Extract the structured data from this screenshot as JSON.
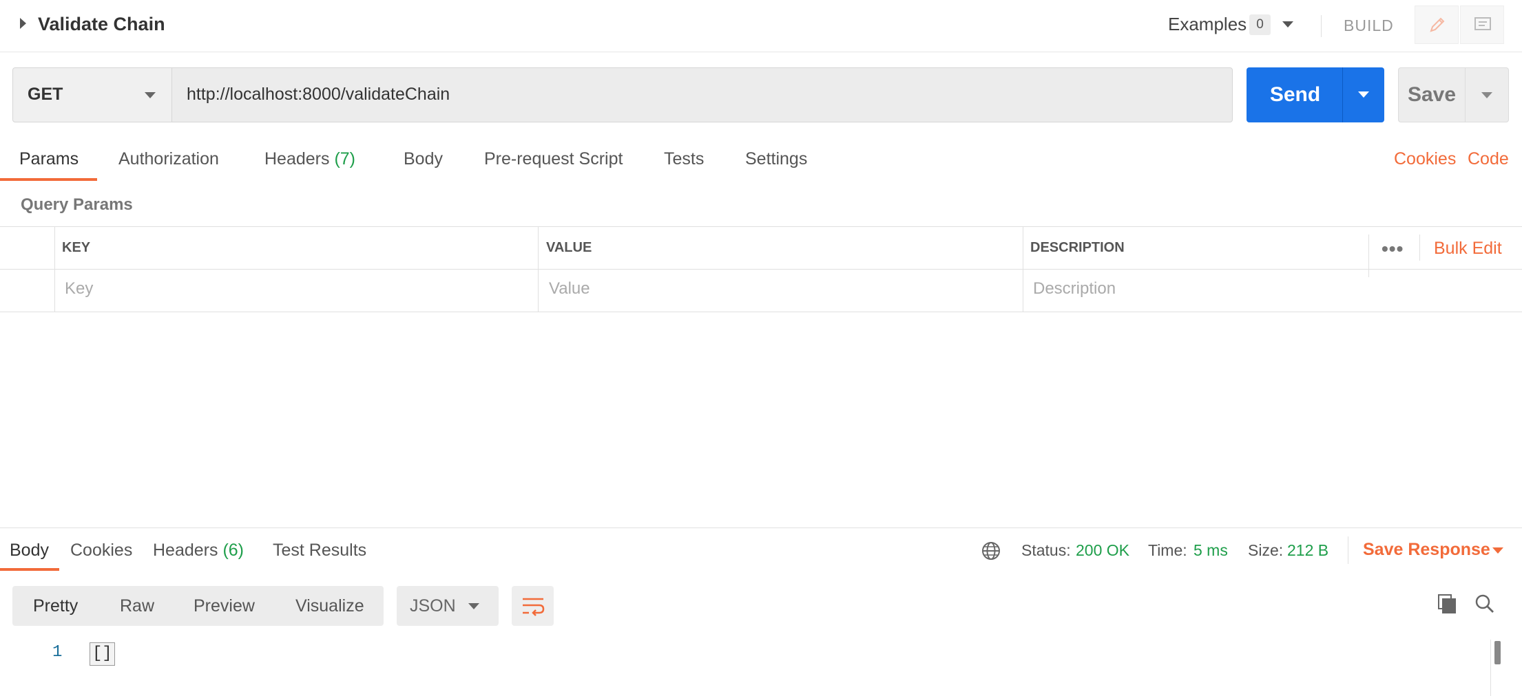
{
  "title_bar": {
    "request_name": "Validate Chain",
    "examples_label": "Examples",
    "examples_count": "0",
    "build_label": "BUILD"
  },
  "request": {
    "method": "GET",
    "url": "http://localhost:8000/validateChain",
    "send_label": "Send",
    "save_label": "Save"
  },
  "request_tabs": {
    "params": "Params",
    "authorization": "Authorization",
    "headers": "Headers",
    "headers_count": "(7)",
    "body": "Body",
    "pre_request_script": "Pre-request Script",
    "tests": "Tests",
    "settings": "Settings"
  },
  "links": {
    "cookies": "Cookies",
    "code": "Code"
  },
  "query_params": {
    "section_label": "Query Params",
    "columns": [
      "KEY",
      "VALUE",
      "DESCRIPTION"
    ],
    "placeholders": [
      "Key",
      "Value",
      "Description"
    ],
    "more_label": "•••",
    "bulk_edit_label": "Bulk Edit"
  },
  "response": {
    "tabs": {
      "body": "Body",
      "cookies": "Cookies",
      "headers": "Headers",
      "headers_count": "(6)",
      "test_results": "Test Results"
    },
    "status_label": "Status:",
    "status_value": "200 OK",
    "time_label": "Time:",
    "time_value": "5 ms",
    "size_label": "Size:",
    "size_value": "212 B",
    "save_response_label": "Save Response",
    "view_modes": [
      "Pretty",
      "Raw",
      "Preview",
      "Visualize"
    ],
    "format": "JSON",
    "lines": [
      {
        "number": "1",
        "text": "[]"
      }
    ]
  },
  "colors": {
    "accent_orange": "#f26b3a",
    "send_blue": "#1a73e8",
    "success_green": "#1e9e4a"
  },
  "icons": {
    "title_expand": "triangle-right-icon",
    "edit": "pencil-icon",
    "comments": "comment-icon",
    "globe": "globe-icon",
    "wrap": "wrap-lines-icon",
    "copy": "copy-icon",
    "search": "search-icon"
  }
}
